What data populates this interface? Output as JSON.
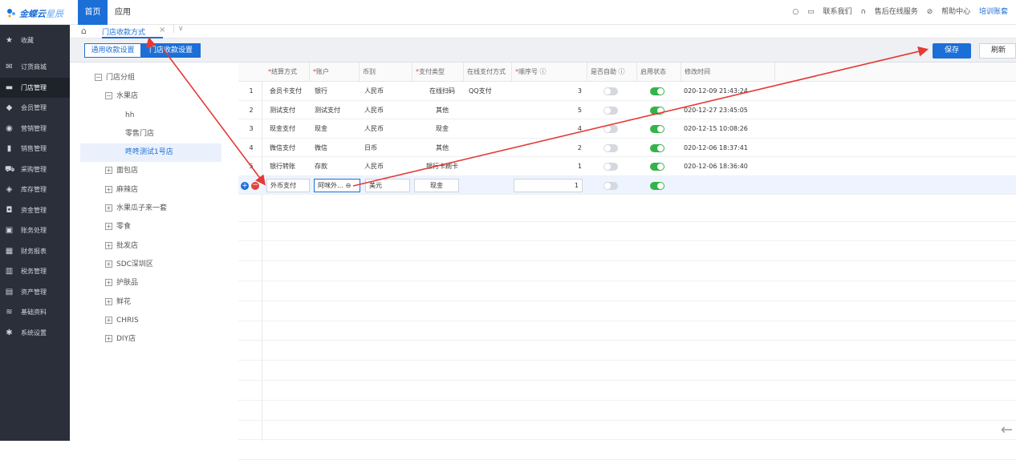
{
  "header": {
    "logo_text": "金蝶云",
    "logo_sub": "星辰",
    "nav_home": "首页",
    "nav_app": "应用",
    "search_glyph": "○",
    "contact": "联系我们",
    "after_sales": "售后在线服务",
    "help": "帮助中心",
    "training": "培训账套"
  },
  "sidebar": {
    "items": [
      {
        "label": "收藏",
        "icon": "star-icon",
        "glyph": "★"
      },
      {
        "label": "订货商城",
        "icon": "mail-icon",
        "glyph": "✉"
      },
      {
        "label": "门店管理",
        "icon": "store-icon",
        "glyph": "▬"
      },
      {
        "label": "会员管理",
        "icon": "diamond-icon",
        "glyph": "◆"
      },
      {
        "label": "营销管理",
        "icon": "marketing-icon",
        "glyph": "◉"
      },
      {
        "label": "销售管理",
        "icon": "bar-chart-icon",
        "glyph": "▮"
      },
      {
        "label": "采购管理",
        "icon": "cart-icon",
        "glyph": "⛟"
      },
      {
        "label": "库存管理",
        "icon": "box-icon",
        "glyph": "◈"
      },
      {
        "label": "资金管理",
        "icon": "money-icon",
        "glyph": "◘"
      },
      {
        "label": "账务处理",
        "icon": "ledger-icon",
        "glyph": "▣"
      },
      {
        "label": "财务报表",
        "icon": "report-icon",
        "glyph": "▦"
      },
      {
        "label": "税务管理",
        "icon": "tax-icon",
        "glyph": "▥"
      },
      {
        "label": "资产管理",
        "icon": "asset-icon",
        "glyph": "▤"
      },
      {
        "label": "基础资料",
        "icon": "layers-icon",
        "glyph": "≋"
      },
      {
        "label": "系统设置",
        "icon": "gear-icon",
        "glyph": "✱"
      }
    ]
  },
  "tabs": {
    "active_label": "门店收款方式",
    "close": "×",
    "more": "∨",
    "home_glyph": "⌂"
  },
  "toolbar": {
    "general": "通用收款设置",
    "store": "门店收款设置",
    "save": "保存",
    "refresh": "刷新"
  },
  "tree": {
    "nodes": [
      {
        "label": "门店分组",
        "toggle": "−",
        "level": 0
      },
      {
        "label": "水果店",
        "toggle": "−",
        "level": 1
      },
      {
        "label": "hh",
        "toggle": "",
        "level": 2
      },
      {
        "label": "零售门店",
        "toggle": "",
        "level": 2
      },
      {
        "label": "咚咚测试1号店",
        "toggle": "",
        "level": 2,
        "selected": true
      },
      {
        "label": "面包店",
        "toggle": "+",
        "level": 1
      },
      {
        "label": "麻辣店",
        "toggle": "+",
        "level": 1
      },
      {
        "label": "水果瓜子来一套",
        "toggle": "+",
        "level": 1
      },
      {
        "label": "零食",
        "toggle": "+",
        "level": 1
      },
      {
        "label": "批发店",
        "toggle": "+",
        "level": 1
      },
      {
        "label": "SDC深圳区",
        "toggle": "+",
        "level": 1
      },
      {
        "label": "护肤品",
        "toggle": "+",
        "level": 1
      },
      {
        "label": "鲜花",
        "toggle": "+",
        "level": 1
      },
      {
        "label": "CHRIS",
        "toggle": "+",
        "level": 1
      },
      {
        "label": "DIY店",
        "toggle": "+",
        "level": 1
      }
    ]
  },
  "grid": {
    "headers": {
      "settle": "结算方式",
      "account": "账户",
      "currency": "币别",
      "pay_type": "支付类型",
      "online": "在线支付方式",
      "order": "顺序号",
      "self": "是否自助",
      "enabled": "启用状态",
      "modified": "修改时间",
      "req": "*",
      "help_glyph": "ⓘ"
    },
    "rows": [
      {
        "no": "1",
        "settle": "会员卡支付",
        "account": "银行",
        "currency": "人民币",
        "pay_type": "在线扫码",
        "online": "QQ支付",
        "order": "3",
        "self": false,
        "enabled": true,
        "modified": "020-12-09 21:43:24"
      },
      {
        "no": "2",
        "settle": "测试支付",
        "account": "测试支付",
        "currency": "人民币",
        "pay_type": "其他",
        "online": "",
        "order": "5",
        "self": false,
        "enabled": true,
        "modified": "020-12-27 23:45:05"
      },
      {
        "no": "3",
        "settle": "现金支付",
        "account": "现金",
        "currency": "人民币",
        "pay_type": "现金",
        "online": "",
        "order": "4",
        "self": false,
        "enabled": true,
        "modified": "020-12-15 10:08:26"
      },
      {
        "no": "4",
        "settle": "微信支付",
        "account": "微信",
        "currency": "日币",
        "pay_type": "其他",
        "online": "",
        "order": "2",
        "self": false,
        "enabled": true,
        "modified": "020-12-06 18:37:41"
      },
      {
        "no": "5",
        "settle": "银行转账",
        "account": "存款",
        "currency": "人民币",
        "pay_type": "银行卡刷卡",
        "online": "",
        "order": "1",
        "self": false,
        "enabled": true,
        "modified": "020-12-06 18:36:40"
      }
    ],
    "edit_row": {
      "settle": "外币支付",
      "account": "阿咪外...",
      "account_icon": "⊖",
      "currency": "美元",
      "pay_type": "现金",
      "order": "1",
      "self": false,
      "enabled": true
    }
  },
  "colors": {
    "accent": "#1c6fd6",
    "sidebar_bg": "#2b2f3a",
    "switch_on": "#34b34a",
    "annotation_arrow": "#e53935"
  }
}
